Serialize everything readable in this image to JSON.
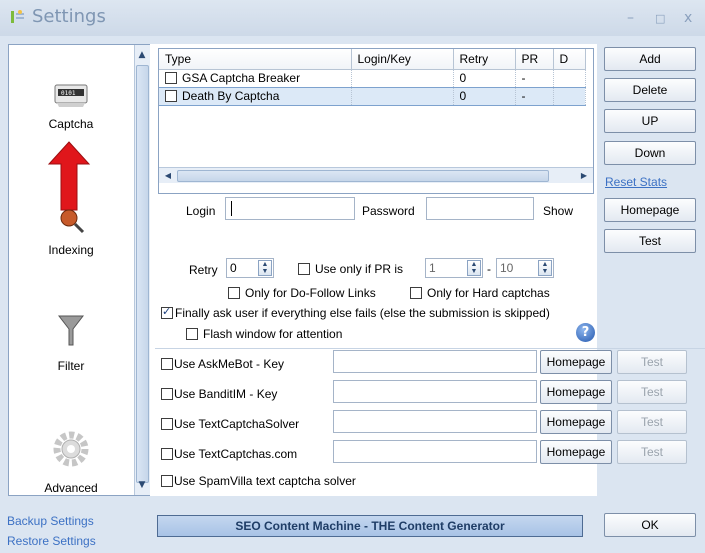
{
  "window": {
    "title": "Settings",
    "minimize": "–",
    "maximize": "□",
    "close": "x"
  },
  "sidebar": {
    "items": [
      {
        "label": "Captcha",
        "icon": "captcha-icon"
      },
      {
        "label": "Indexing",
        "icon": "indexing-icon"
      },
      {
        "label": "Filter",
        "icon": "filter-icon"
      },
      {
        "label": "Advanced",
        "icon": "gear-icon"
      }
    ]
  },
  "grid": {
    "columns": [
      "Type",
      "Login/Key",
      "Retry",
      "PR",
      "D"
    ],
    "rows": [
      {
        "type": "GSA Captcha Breaker",
        "login": "",
        "retry": "0",
        "pr": "-",
        "d": ""
      },
      {
        "type": "Death By Captcha",
        "login": "",
        "retry": "0",
        "pr": "-",
        "d": ""
      }
    ]
  },
  "right_buttons": {
    "add": "Add",
    "delete": "Delete",
    "up": "UP",
    "down": "Down",
    "reset": "Reset Stats",
    "homepage": "Homepage",
    "test": "Test"
  },
  "form": {
    "login_label": "Login",
    "login_value": "",
    "password_label": "Password",
    "password_value": "",
    "show_label": "Show",
    "retry_label": "Retry",
    "retry_value": "0",
    "use_pr_label": "Use only if PR is",
    "pr_min": "1",
    "pr_dash": "-",
    "pr_max": "10",
    "dofollow_label": "Only for Do-Follow Links",
    "hard_label": "Only for Hard captchas",
    "finally_label": "Finally ask user if everything else fails (else the submission is skipped)",
    "flash_label": "Flash window for attention",
    "help": "?"
  },
  "services": [
    {
      "label": "Use AskMeBot - Key",
      "homepage": "Homepage",
      "test": "Test"
    },
    {
      "label": "Use BanditIM - Key",
      "homepage": "Homepage",
      "test": "Test"
    },
    {
      "label": "Use TextCaptchaSolver",
      "homepage": "Homepage",
      "test": "Test"
    },
    {
      "label": "Use TextCaptchas.com",
      "homepage": "Homepage",
      "test": "Test"
    },
    {
      "label": "Use SpamVilla text captcha solver"
    }
  ],
  "footer": {
    "backup": "Backup Settings",
    "restore": "Restore Settings",
    "status": "SEO Content Machine - THE Content Generator",
    "ok": "OK"
  },
  "colors": {
    "accent": "#3c71c4",
    "frame": "#dbe5f1",
    "arrow": "#e0161b"
  }
}
